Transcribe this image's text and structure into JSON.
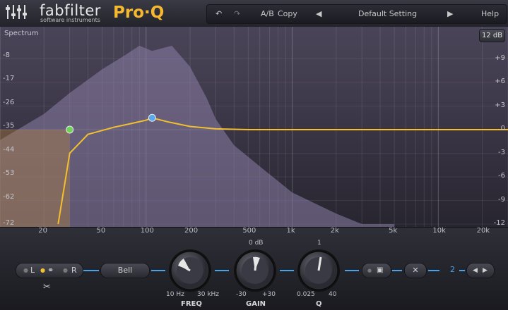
{
  "header": {
    "brand": "fabfilter",
    "brand_sub": "software instruments",
    "product": "Pro·Q",
    "ab_label": "A/B",
    "copy_label": "Copy",
    "preset": "Default Setting",
    "help_label": "Help"
  },
  "graph": {
    "spectrum_label": "Spectrum",
    "range_label": "12 dB",
    "left_axis": [
      "-8",
      "-17",
      "-26",
      "-35",
      "-44",
      "-53",
      "-62",
      "-72"
    ],
    "right_axis": [
      "+9",
      "+6",
      "+3",
      "0",
      "-3",
      "-6",
      "-9",
      "-12"
    ],
    "freq_axis": [
      "20",
      "50",
      "100",
      "200",
      "500",
      "1k",
      "2k",
      "5k",
      "10k",
      "20k"
    ]
  },
  "controls": {
    "channel_l": "L",
    "channel_r": "R",
    "shape_label": "Bell",
    "freq_label": "FREQ",
    "freq_min": "10 Hz",
    "freq_max": "30 kHz",
    "gain_label": "GAIN",
    "gain_top": "0 dB",
    "gain_min": "-30",
    "gain_max": "+30",
    "q_label": "Q",
    "q_top": "1",
    "q_min": "0.025",
    "q_max": "40",
    "band_number": "2"
  },
  "chart_data": {
    "type": "line",
    "title": "",
    "xlabel": "",
    "ylabel": "",
    "x_scale": "log",
    "xlim": [
      10,
      30000
    ],
    "ylim_eq_db": [
      -12,
      12
    ],
    "ylim_spectrum_db": [
      -72,
      0
    ],
    "grid": true,
    "series": [
      {
        "role": "eq-curve",
        "x": [
          25,
          30,
          40,
          60,
          80,
          100,
          110,
          140,
          200,
          300,
          500,
          1000,
          20000
        ],
        "y": [
          -12,
          -3,
          -0.6,
          0.3,
          0.8,
          1.2,
          1.5,
          1.0,
          0.4,
          0.1,
          0.0,
          0.0,
          0.0
        ]
      },
      {
        "role": "spectrum",
        "x": [
          10,
          20,
          30,
          50,
          70,
          90,
          110,
          150,
          200,
          260,
          300,
          400,
          600,
          1000,
          2000,
          3000,
          5000
        ],
        "y": [
          -40,
          -30,
          -22,
          -13,
          -8,
          -4,
          -6,
          -4,
          -12,
          -24,
          -32,
          -42,
          -50,
          -60,
          -68,
          -72,
          -72
        ]
      }
    ],
    "bands": [
      {
        "band": 1,
        "freq": 30,
        "gain_db": 0,
        "color": "#6fd35a"
      },
      {
        "band": 2,
        "freq": 110,
        "gain_db": 1.5,
        "color": "#5aa8ec",
        "selected": true
      }
    ],
    "curve_color": "#f2c02e",
    "spectrum_color": "#8c7fa8"
  }
}
